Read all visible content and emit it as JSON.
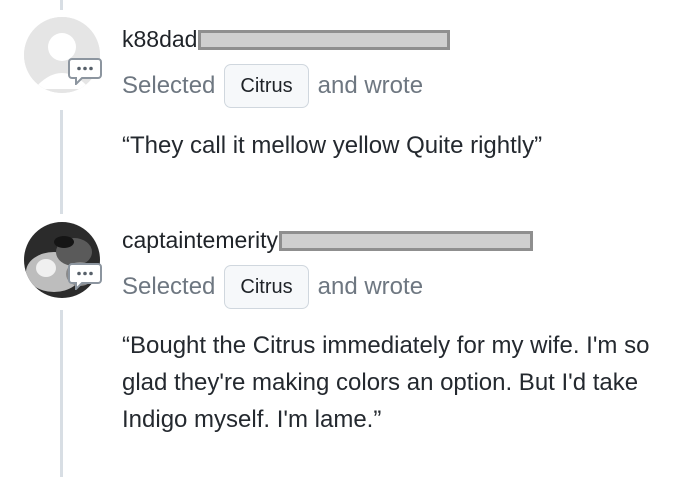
{
  "comments": [
    {
      "username": "k88dad",
      "selected_prefix": "Selected",
      "option": "Citrus",
      "wrote_suffix": "and wrote",
      "text": "“They call it mellow yellow Quite rightly”",
      "avatar": "default-avatar",
      "reply_icon": "speech-bubble-icon"
    },
    {
      "username": "captaintemerity",
      "selected_prefix": "Selected",
      "option": "Citrus",
      "wrote_suffix": "and wrote",
      "text": "“Bought the Citrus immediately for my wife. I'm so glad they're making colors an option. But I'd take Indigo myself. I'm lame.”",
      "avatar": "photo-avatar",
      "reply_icon": "speech-bubble-icon"
    }
  ],
  "colors": {
    "timeline": "#d8dee4",
    "muted_text": "#6e7781",
    "pill_bg": "#f6f8fa"
  }
}
